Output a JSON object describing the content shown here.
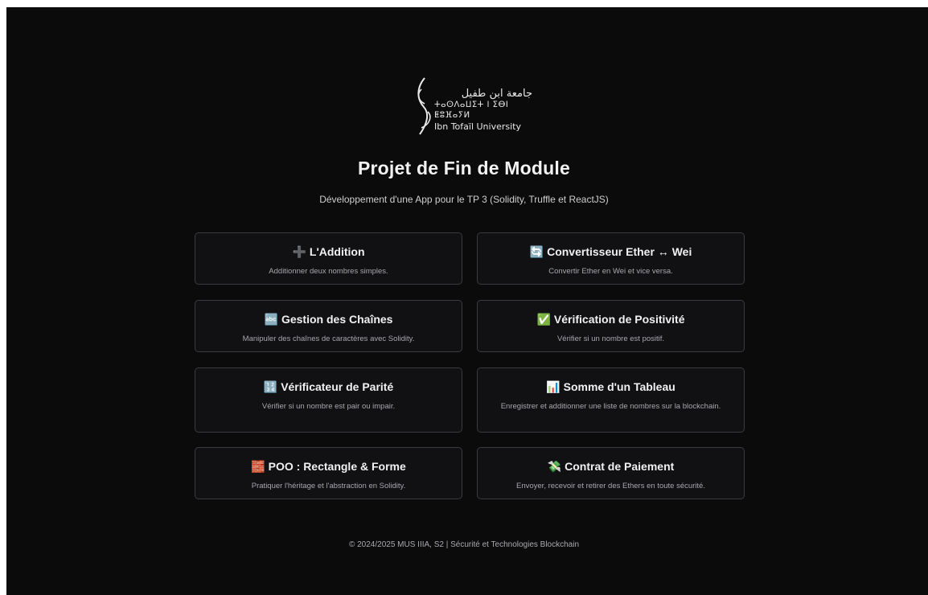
{
  "logo": {
    "arabic": "جامعة ابن طفيل",
    "tifinagh": "ⵜⴰⵙⴷⴰⵡⵉⵜ ⵏ ⵉⴱⵏ ⵟⵓⴼⴰⵢⵍ",
    "english": "Ibn Tofaïl University"
  },
  "header": {
    "title": "Projet de Fin de Module",
    "subtitle": "Développement d'une App pour le TP 3 (Solidity, Truffle et ReactJS)"
  },
  "cards": [
    {
      "icon": "plus-icon",
      "emoji": "➕",
      "title": "L'Addition",
      "desc": "Additionner deux nombres simples."
    },
    {
      "icon": "refresh-icon",
      "emoji": "🔄",
      "title": "Convertisseur Ether ↔ Wei",
      "desc": "Convertir Ether en Wei et vice versa."
    },
    {
      "icon": "abc-icon",
      "emoji": "🔤",
      "title": "Gestion des Chaînes",
      "desc": "Manipuler des chaînes de caractères avec Solidity."
    },
    {
      "icon": "checkmark-icon",
      "emoji": "✅",
      "title": "Vérification de Positivité",
      "desc": "Vérifier si un nombre est positif."
    },
    {
      "icon": "numbers-icon",
      "emoji": "🔢",
      "title": "Vérificateur de Parité",
      "desc": "Vérifier si un nombre est pair ou impair."
    },
    {
      "icon": "bar-chart-icon",
      "emoji": "📊",
      "title": "Somme d'un Tableau",
      "desc": "Enregistrer et additionner une liste de nombres sur la blockchain."
    },
    {
      "icon": "bricks-icon",
      "emoji": "🧱",
      "title": "POO : Rectangle & Forme",
      "desc": "Pratiquer l'héritage et l'abstraction en Solidity."
    },
    {
      "icon": "money-icon",
      "emoji": "💸",
      "title": "Contrat de Paiement",
      "desc": "Envoyer, recevoir et retirer des Ethers en toute sécurité."
    }
  ],
  "footer": {
    "text": "© 2024/2025 MUS IIIA, S2 | Sécurité et Technologies Blockchain"
  }
}
